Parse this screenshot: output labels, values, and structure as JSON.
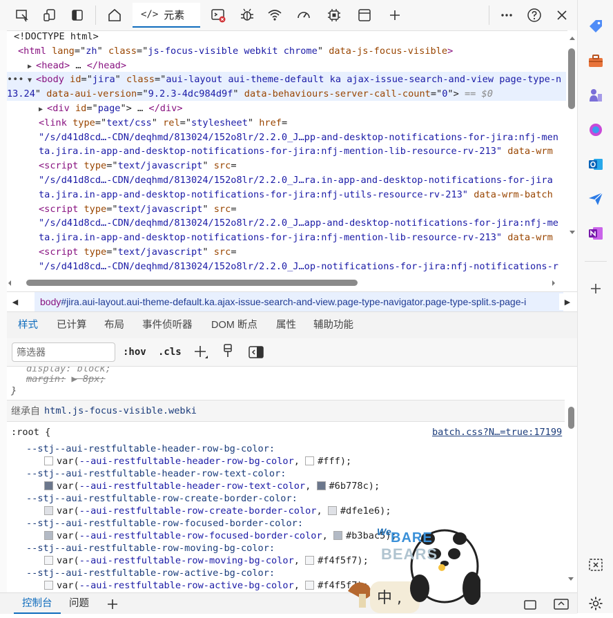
{
  "toolbar": {
    "elements_tab": "元素"
  },
  "dom": {
    "lines": [
      {
        "indent": "  ",
        "parts": [
          [
            "t",
            "<!DOCTYPE html>"
          ]
        ]
      },
      {
        "indent": "  ",
        "parts": [
          [
            "tag",
            "<html "
          ],
          [
            "an",
            "lang"
          ],
          [
            "t",
            "=\""
          ],
          [
            "av",
            "zh"
          ],
          [
            "t",
            "\" "
          ],
          [
            "an",
            "class"
          ],
          [
            "t",
            "=\""
          ],
          [
            "av",
            "js-focus-visible webkit chrome"
          ],
          [
            "t",
            "\" "
          ],
          [
            "an",
            "data-js-focus-visible"
          ],
          [
            "tag",
            ">"
          ]
        ]
      },
      {
        "indent": "    ",
        "parts": [
          [
            "tag",
            "<head>"
          ],
          [
            "t",
            " … "
          ],
          [
            "tag",
            "</head>"
          ]
        ]
      },
      {
        "indent": "    ",
        "parts": [
          [
            "tag",
            "<body "
          ],
          [
            "an",
            "id"
          ],
          [
            "t",
            "=\""
          ],
          [
            "av",
            "jira"
          ],
          [
            "t",
            "\" "
          ],
          [
            "an",
            "class"
          ],
          [
            "t",
            "=\""
          ],
          [
            "av",
            "aui-layout aui-theme-default ka ajax-issue-search-and-view page-type-n"
          ]
        ]
      },
      {
        "indent": "",
        "parts": [
          [
            "av",
            "13.24"
          ],
          [
            "t",
            "\" "
          ],
          [
            "an",
            "data-aui-version"
          ],
          [
            "t",
            "=\""
          ],
          [
            "av",
            "9.2.3-4dc984d9f"
          ],
          [
            "t",
            "\" "
          ],
          [
            "an",
            "data-behaviours-server-call-count"
          ],
          [
            "t",
            "=\""
          ],
          [
            "av",
            "0"
          ],
          [
            "t",
            "\">"
          ],
          [
            "dim",
            " == $0"
          ]
        ]
      },
      {
        "indent": "      ",
        "parts": [
          [
            "tag",
            "<div "
          ],
          [
            "an",
            "id"
          ],
          [
            "t",
            "=\""
          ],
          [
            "av",
            "page"
          ],
          [
            "t",
            "\">"
          ],
          [
            "t",
            " … "
          ],
          [
            "tag",
            "</div>"
          ]
        ]
      },
      {
        "indent": "      ",
        "parts": [
          [
            "tag",
            "<link "
          ],
          [
            "an",
            "type"
          ],
          [
            "t",
            "=\""
          ],
          [
            "av",
            "text/css"
          ],
          [
            "t",
            "\" "
          ],
          [
            "an",
            "rel"
          ],
          [
            "t",
            "=\""
          ],
          [
            "av",
            "stylesheet"
          ],
          [
            "t",
            "\" "
          ],
          [
            "an",
            "href"
          ],
          [
            "t",
            "="
          ]
        ]
      },
      {
        "indent": "      ",
        "parts": [
          [
            "av",
            "\"/s/d41d8cd…-CDN/deqhmd/813024/152o8lr/2.2.0_J…pp-and-desktop-notifications-for-jira:nfj-men"
          ]
        ]
      },
      {
        "indent": "      ",
        "parts": [
          [
            "av",
            "ta.jira.in-app-and-desktop-notifications-for-jira:nfj-mention-lib-resource-rv-213\""
          ],
          [
            "t",
            " "
          ],
          [
            "an",
            "data-wrm"
          ]
        ]
      },
      {
        "indent": "      ",
        "parts": [
          [
            "tag",
            "<script "
          ],
          [
            "an",
            "type"
          ],
          [
            "t",
            "=\""
          ],
          [
            "av",
            "text/javascript"
          ],
          [
            "t",
            "\" "
          ],
          [
            "an",
            "src"
          ],
          [
            "t",
            "="
          ]
        ]
      },
      {
        "indent": "      ",
        "parts": [
          [
            "av",
            "\"/s/d41d8cd…-CDN/deqhmd/813024/152o8lr/2.2.0_J…ra.in-app-and-desktop-notifications-for-jira"
          ]
        ]
      },
      {
        "indent": "      ",
        "parts": [
          [
            "av",
            "ta.jira.in-app-and-desktop-notifications-for-jira:nfj-utils-resource-rv-213\""
          ],
          [
            "t",
            " "
          ],
          [
            "an",
            "data-wrm-batch"
          ]
        ]
      },
      {
        "indent": "      ",
        "parts": [
          [
            "tag",
            "<script "
          ],
          [
            "an",
            "type"
          ],
          [
            "t",
            "=\""
          ],
          [
            "av",
            "text/javascript"
          ],
          [
            "t",
            "\" "
          ],
          [
            "an",
            "src"
          ],
          [
            "t",
            "="
          ]
        ]
      },
      {
        "indent": "      ",
        "parts": [
          [
            "av",
            "\"/s/d41d8cd…-CDN/deqhmd/813024/152o8lr/2.2.0_J…app-and-desktop-notifications-for-jira:nfj-me"
          ]
        ]
      },
      {
        "indent": "      ",
        "parts": [
          [
            "av",
            "ta.jira.in-app-and-desktop-notifications-for-jira:nfj-mention-lib-resource-rv-213\""
          ],
          [
            "t",
            " "
          ],
          [
            "an",
            "data-wrm"
          ]
        ]
      },
      {
        "indent": "      ",
        "parts": [
          [
            "tag",
            "<script "
          ],
          [
            "an",
            "type"
          ],
          [
            "t",
            "=\""
          ],
          [
            "av",
            "text/javascript"
          ],
          [
            "t",
            "\" "
          ],
          [
            "an",
            "src"
          ],
          [
            "t",
            "="
          ]
        ]
      },
      {
        "indent": "      ",
        "parts": [
          [
            "av",
            "\"/s/d41d8cd…-CDN/deqhmd/813024/152o8lr/2.2.0_J…op-notifications-for-jira:nfj-notifications-r"
          ]
        ]
      }
    ]
  },
  "breadcrumb": {
    "tag": "body",
    "rest": "#jira.aui-layout.aui-theme-default.ka.ajax-issue-search-and-view.page-type-navigator.page-type-split.s-page-i"
  },
  "style_tabs": [
    "样式",
    "已计算",
    "布局",
    "事件侦听器",
    "DOM 断点",
    "属性",
    "辅助功能"
  ],
  "filter": {
    "placeholder": "筛选器",
    "hov": ":hov",
    "cls": ".cls"
  },
  "styles": {
    "prev_rule_prop": "margin:",
    "prev_rule_value": "8px;",
    "closing_brace": "}",
    "inherited_label": "继承自",
    "inherited_from": "html.js-focus-visible.webki",
    "root_selector": ":root {",
    "source_link": "batch.css?N…=true:17199",
    "props": [
      {
        "name": "--stj--aui-restfultable-header-row-bg-color:",
        "var": "--aui-restfultable-header-row-bg-color",
        "fallback": "#fff",
        "color": "#ffffff"
      },
      {
        "name": "--stj--aui-restfultable-header-row-text-color:",
        "var": "--aui-restfultable-header-row-text-color",
        "fallback": "#6b778c",
        "color": "#6b778c"
      },
      {
        "name": "--stj--aui-restfultable-row-create-border-color:",
        "var": "--aui-restfultable-row-create-border-color",
        "fallback": "#dfe1e6",
        "color": "#dfe1e6"
      },
      {
        "name": "--stj--aui-restfultable-row-focused-border-color:",
        "var": "--aui-restfultable-row-focused-border-color",
        "fallback": "#b3bac5",
        "color": "#b3bac5"
      },
      {
        "name": "--stj--aui-restfultable-row-moving-bg-color:",
        "var": "--aui-restfultable-row-moving-bg-color",
        "fallback": "#f4f5f7",
        "color": "#f4f5f7"
      },
      {
        "name": "--stj--aui-restfultable-row-active-bg-color:",
        "var": "--aui-restfultable-row-active-bg-color",
        "fallback": "#f4f5f7",
        "color": "#f4f5f7"
      }
    ]
  },
  "drawer": {
    "console": "控制台",
    "issues": "问题"
  },
  "sticker": {
    "line1": "We",
    "line2": "BARE",
    "line3": "BEARS",
    "chars": "中 ,"
  }
}
